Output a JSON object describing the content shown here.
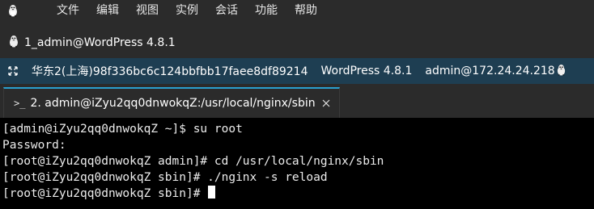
{
  "menubar": {
    "app_icon": "tux-icon",
    "items": [
      "文件",
      "编辑",
      "视图",
      "实例",
      "会话",
      "功能",
      "帮助"
    ]
  },
  "session_tab": {
    "icon": "tux-icon",
    "label": "1_admin@WordPress 4.8.1"
  },
  "infobar": {
    "icon": "expand-icon",
    "instance": "华东2(上海)98f336bc6c124bbfbb17faee8df89214",
    "image": "WordPress 4.8.1",
    "login": "admin@172.24.24.218",
    "login_icon": "tux-icon"
  },
  "terminal_tab": {
    "icon": "terminal-prompt-icon",
    "label": "2. admin@iZyu2qq0dnwokqZ:/usr/local/nginx/sbin",
    "close_icon": "close-icon"
  },
  "terminal": {
    "lines": [
      "[admin@iZyu2qq0dnwokqZ ~]$ su root",
      "Password:",
      "[root@iZyu2qq0dnwokqZ admin]# cd /usr/local/nginx/sbin",
      "[root@iZyu2qq0dnwokqZ sbin]# ./nginx -s reload",
      "[root@iZyu2qq0dnwokqZ sbin]# "
    ]
  },
  "colors": {
    "menubar_bg": "#2b2b2b",
    "infobar_bg": "#1e3e52",
    "tab_accent": "#2aa0d0",
    "terminal_bg": "#000000",
    "terminal_fg": "#ececec"
  }
}
